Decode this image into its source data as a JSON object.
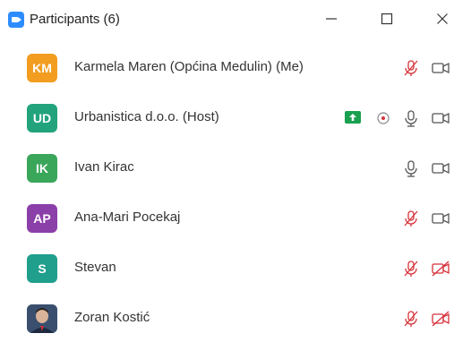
{
  "window": {
    "title": "Participants (6)",
    "controls": [
      "minimize",
      "maximize",
      "close"
    ]
  },
  "colors": {
    "accent": "#2d8cff",
    "muted_red": "#d6323a",
    "share_green": "#1aa04f"
  },
  "participants": [
    {
      "initials": "KM",
      "name": "Karmela Maren (Općina Medulin) (Me)",
      "avatar_color": "#f29d1f",
      "mic": "muted",
      "video": "on"
    },
    {
      "initials": "UD",
      "name": "Urbanistica d.o.o. (Host)",
      "avatar_color": "#23a37c",
      "mic": "on",
      "video": "on",
      "sharing": true,
      "recording": true
    },
    {
      "initials": "IK",
      "name": "Ivan Kirac",
      "avatar_color": "#3aa65a",
      "mic": "on",
      "video": "on"
    },
    {
      "initials": "AP",
      "name": "Ana-Mari Pocekaj",
      "avatar_color": "#8b3fa9",
      "mic": "muted",
      "video": "on"
    },
    {
      "initials": "S",
      "name": "Stevan",
      "avatar_color": "#1f9f8c",
      "mic": "muted",
      "video": "off"
    },
    {
      "initials": "",
      "name": "Zoran Kostić",
      "avatar_color": "#3a4f6e",
      "mic": "muted",
      "video": "off"
    }
  ]
}
